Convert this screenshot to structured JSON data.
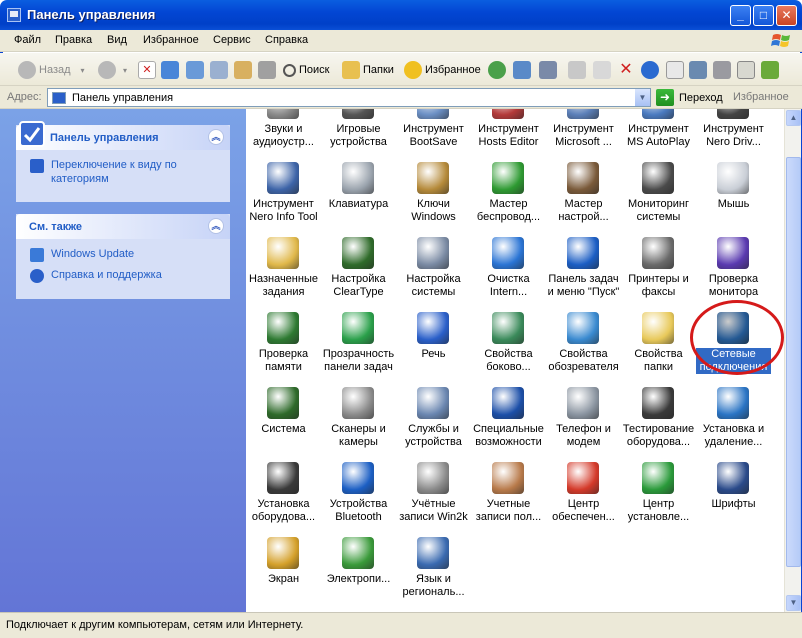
{
  "window": {
    "title": "Панель управления",
    "min_label": "_",
    "max_label": "□",
    "close_label": "✕"
  },
  "menu": [
    "Файл",
    "Правка",
    "Вид",
    "Избранное",
    "Сервис",
    "Справка"
  ],
  "toolbar": {
    "back": "Назад",
    "search": "Поиск",
    "folders": "Папки",
    "favorites": "Избранное"
  },
  "address": {
    "label": "Адрес:",
    "value": "Панель управления",
    "go": "Переход",
    "links": "Избранное"
  },
  "left_panel": {
    "cp_title": "Панель управления",
    "switch_view": "Переключение к виду по категориям",
    "see_also_title": "См. также",
    "see_also": [
      "Windows Update",
      "Справка и поддержка"
    ]
  },
  "items": [
    {
      "label": "Звуки и\nаудиоустр...",
      "icon": "sound-icon",
      "color": "#8a8a8a"
    },
    {
      "label": "Игровые\nустройства",
      "icon": "gamepad-icon",
      "color": "#555555"
    },
    {
      "label": "Инструмент\nBootSave",
      "icon": "tool-icon",
      "color": "#6b8fc4"
    },
    {
      "label": "Инструмент\nHosts Editor",
      "icon": "tool-icon",
      "color": "#b33a3a"
    },
    {
      "label": "Инструмент\nMicrosoft ...",
      "icon": "tool-icon",
      "color": "#5b7fb8"
    },
    {
      "label": "Инструмент\nMS AutoPlay",
      "icon": "tool-icon",
      "color": "#4a7ac0"
    },
    {
      "label": "Инструмент\nNero Driv...",
      "icon": "tool-icon",
      "color": "#444444"
    },
    {
      "label": "Инструмент\nNero Info Tool",
      "icon": "disk-icon",
      "color": "#3d64a8"
    },
    {
      "label": "Клавиатура",
      "icon": "keyboard-icon",
      "color": "#9aa3ad"
    },
    {
      "label": "Ключи\nWindows",
      "icon": "keys-icon",
      "color": "#b58a3a"
    },
    {
      "label": "Мастер\nбеспровод...",
      "icon": "wireless-icon",
      "color": "#2e9a32"
    },
    {
      "label": "Мастер\nнастрой...",
      "icon": "network-house-icon",
      "color": "#7a5a3a"
    },
    {
      "label": "Мониторинг\nсистемы",
      "icon": "gauge-icon",
      "color": "#4a4a4a"
    },
    {
      "label": "Мышь",
      "icon": "mouse-icon",
      "color": "#c9ced6"
    },
    {
      "label": "Назначенные\nзадания",
      "icon": "clock-folder-icon",
      "color": "#e0b84a"
    },
    {
      "label": "Настройка\nClearType",
      "icon": "cleartype-icon",
      "color": "#2f6b2a"
    },
    {
      "label": "Настройка\nсистемы",
      "icon": "system-tools-icon",
      "color": "#7a8aa3"
    },
    {
      "label": "Очистка\nIntern...",
      "icon": "ie-icon",
      "color": "#2a74d4"
    },
    {
      "label": "Панель задач\nи меню \"Пуск\"",
      "icon": "taskbar-icon",
      "color": "#1c5ec4"
    },
    {
      "label": "Принтеры и\nфаксы",
      "icon": "printer-icon",
      "color": "#6a6a6a"
    },
    {
      "label": "Проверка\nмонитора",
      "icon": "monitor-check-icon",
      "color": "#5a3ab0"
    },
    {
      "label": "Проверка\nпамяти",
      "icon": "memory-icon",
      "color": "#2e7a32"
    },
    {
      "label": "Прозрачность\nпанели задач",
      "icon": "transparency-icon",
      "color": "#2aa04a"
    },
    {
      "label": "Речь",
      "icon": "speech-icon",
      "color": "#2a5fc9"
    },
    {
      "label": "Свойства\nбоково...",
      "icon": "sidebar-icon",
      "color": "#3a8a5a"
    },
    {
      "label": "Свойства\nобозревателя",
      "icon": "globe-icon",
      "color": "#3a8ad0"
    },
    {
      "label": "Свойства\nпапки",
      "icon": "folder-icon",
      "color": "#e8c95a"
    },
    {
      "label": "Сетевые\nподключения",
      "icon": "network-globe-icon",
      "color": "#2d6fb8",
      "selected": true
    },
    {
      "label": "Система",
      "icon": "computer-icon",
      "color": "#2e6a2a"
    },
    {
      "label": "Сканеры и\nкамеры",
      "icon": "scanner-icon",
      "color": "#8a8a8a"
    },
    {
      "label": "Службы и\nустройства",
      "icon": "services-icon",
      "color": "#6a86b0"
    },
    {
      "label": "Специальные\nвозможности",
      "icon": "accessibility-icon",
      "color": "#1c4fa8"
    },
    {
      "label": "Телефон и\nмодем",
      "icon": "phone-icon",
      "color": "#8a94a0"
    },
    {
      "label": "Тестирование\nоборудова...",
      "icon": "chart-icon",
      "color": "#3a3a3a"
    },
    {
      "label": "Установка и\nудаление...",
      "icon": "install-icon",
      "color": "#2a74c4"
    },
    {
      "label": "Установка\nоборудова...",
      "icon": "hardware-icon",
      "color": "#3a3a3a"
    },
    {
      "label": "Устройства\nBluetooth",
      "icon": "bluetooth-icon",
      "color": "#1c5fc4"
    },
    {
      "label": "Учётные\nзаписи Win2k",
      "icon": "lock-icon",
      "color": "#8a8a8a"
    },
    {
      "label": "Учетные\nзаписи пол...",
      "icon": "users-icon",
      "color": "#b87a4a"
    },
    {
      "label": "Центр\nобеспечен...",
      "icon": "shield-icon",
      "color": "#d43a2a"
    },
    {
      "label": "Центр\nустановле...",
      "icon": "shield-check-icon",
      "color": "#2a9a3a"
    },
    {
      "label": "Шрифты",
      "icon": "fonts-icon",
      "color": "#2a4a8a"
    },
    {
      "label": "Экран",
      "icon": "display-icon",
      "color": "#d4a02a"
    },
    {
      "label": "Электропи...",
      "icon": "power-icon",
      "color": "#3a9a3a"
    },
    {
      "label": "Язык и\nрегиональ...",
      "icon": "language-globe-icon",
      "color": "#3a6ab0"
    }
  ],
  "status": "Подключает к другим компьютерам, сетям или Интернету."
}
